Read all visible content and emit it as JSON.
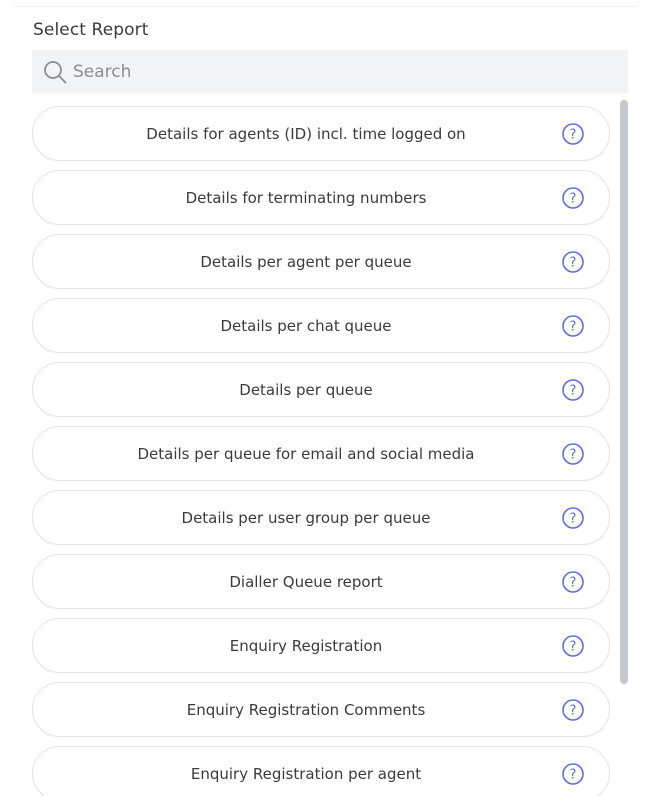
{
  "panel": {
    "title": "Select Report"
  },
  "search": {
    "placeholder": "Search",
    "value": "",
    "icon": "search-icon"
  },
  "colors": {
    "help_icon": "#5b6ee1",
    "search_bg": "#f2f3f5",
    "item_border": "#e3e5e8",
    "scrollbar": "#c4c7cc"
  },
  "reports": [
    {
      "label": "Details for agents (ID) incl. time logged on",
      "help_icon": "question-circle-icon"
    },
    {
      "label": "Details for terminating numbers",
      "help_icon": "question-circle-icon"
    },
    {
      "label": "Details per agent per queue",
      "help_icon": "question-circle-icon"
    },
    {
      "label": "Details per chat queue",
      "help_icon": "question-circle-icon"
    },
    {
      "label": "Details per queue",
      "help_icon": "question-circle-icon"
    },
    {
      "label": "Details per queue for email and social media",
      "help_icon": "question-circle-icon"
    },
    {
      "label": "Details per user group per queue",
      "help_icon": "question-circle-icon"
    },
    {
      "label": "Dialler Queue report",
      "help_icon": "question-circle-icon"
    },
    {
      "label": "Enquiry Registration",
      "help_icon": "question-circle-icon"
    },
    {
      "label": "Enquiry Registration Comments",
      "help_icon": "question-circle-icon"
    },
    {
      "label": "Enquiry Registration per agent",
      "help_icon": "question-circle-icon"
    }
  ]
}
